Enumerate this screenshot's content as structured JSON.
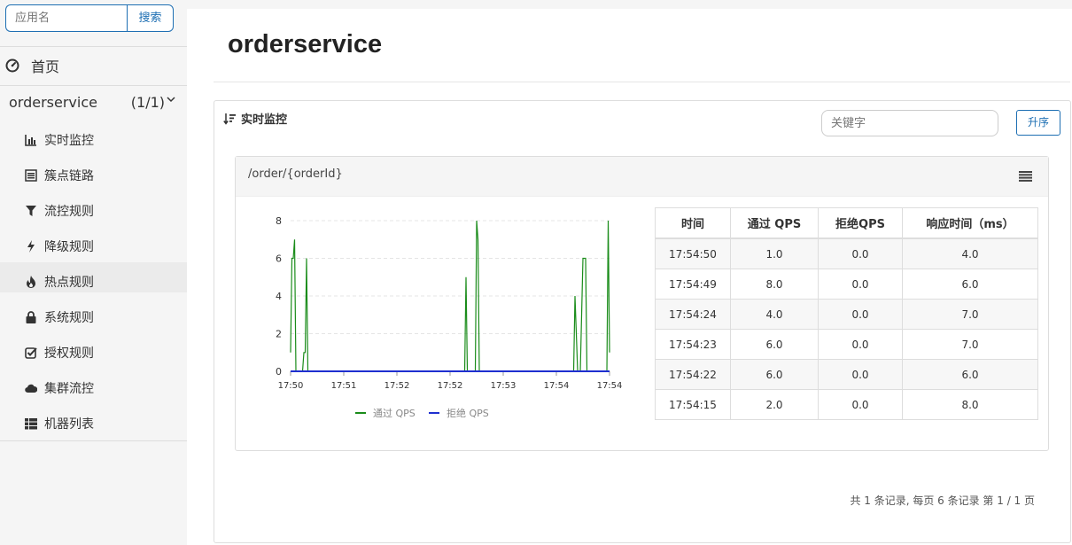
{
  "sidebar": {
    "search": {
      "placeholder": "应用名",
      "button": "搜索"
    },
    "home": {
      "icon": "dashboard-icon",
      "label": "首页"
    },
    "app": {
      "name": "orderservice",
      "count": "(1/1)"
    },
    "menu": [
      {
        "icon": "bar-chart-icon",
        "label": "实时监控"
      },
      {
        "icon": "list-icon",
        "label": "簇点链路"
      },
      {
        "icon": "filter-icon",
        "label": "流控规则"
      },
      {
        "icon": "flash-icon",
        "label": "降级规则"
      },
      {
        "icon": "fire-icon",
        "label": "热点规则"
      },
      {
        "icon": "lock-icon",
        "label": "系统规则"
      },
      {
        "icon": "check-square-icon",
        "label": "授权规则"
      },
      {
        "icon": "cloud-icon",
        "label": "集群流控"
      },
      {
        "icon": "th-list-icon",
        "label": "机器列表"
      }
    ]
  },
  "main": {
    "title": "orderservice",
    "panel": {
      "title": "实时监控",
      "keyword_placeholder": "关键字",
      "sort_button": "升序"
    },
    "resource": {
      "name": "/order/{orderId}"
    },
    "table": {
      "headers": [
        "时间",
        "通过 QPS",
        "拒绝QPS",
        "响应时间（ms）"
      ],
      "rows": [
        [
          "17:54:50",
          "1.0",
          "0.0",
          "4.0"
        ],
        [
          "17:54:49",
          "8.0",
          "0.0",
          "6.0"
        ],
        [
          "17:54:24",
          "4.0",
          "0.0",
          "7.0"
        ],
        [
          "17:54:23",
          "6.0",
          "0.0",
          "7.0"
        ],
        [
          "17:54:22",
          "6.0",
          "0.0",
          "6.0"
        ],
        [
          "17:54:15",
          "2.0",
          "0.0",
          "8.0"
        ]
      ]
    },
    "pagination": "共 1 条记录, 每页 6 条记录 第 1 / 1 页"
  },
  "chart_data": {
    "type": "line",
    "x_ticks": [
      "17:50",
      "17:51",
      "17:52",
      "17:52",
      "17:53",
      "17:54",
      "17:54"
    ],
    "y_ticks": [
      0,
      2,
      4,
      6,
      8
    ],
    "ylim": [
      0,
      8
    ],
    "xlim_seconds": [
      0,
      240
    ],
    "grid": true,
    "legend_position": "bottom",
    "colors": {
      "pass": "#1a8c1a",
      "block": "#1f2fd0"
    },
    "series": [
      {
        "name": "通过 QPS",
        "x_seconds": [
          0,
          1,
          2,
          3,
          4,
          5,
          6,
          7,
          8,
          9,
          10,
          11,
          12,
          13,
          14,
          15,
          16,
          17,
          18,
          19,
          20,
          130,
          131,
          132,
          133,
          134,
          135,
          136,
          137,
          138,
          139,
          140,
          141,
          142,
          143,
          144,
          145,
          210,
          211,
          212,
          213,
          214,
          215,
          216,
          217,
          218,
          219,
          220,
          221,
          222,
          223,
          224,
          236,
          237,
          238,
          239,
          240
        ],
        "values": [
          1,
          6,
          6,
          7,
          0,
          0,
          0,
          0,
          0,
          0,
          1,
          1,
          6,
          0,
          0,
          0,
          0,
          0,
          0,
          0,
          0,
          0,
          0,
          5,
          0,
          0,
          0,
          0,
          0,
          0,
          0,
          8,
          7,
          0,
          0,
          0,
          0,
          0,
          0,
          0,
          0,
          4,
          2,
          0,
          0,
          0,
          3,
          6,
          6,
          6,
          0,
          0,
          0,
          0,
          0,
          8,
          1
        ]
      },
      {
        "name": "拒绝 QPS",
        "x_seconds": [
          0,
          240
        ],
        "values": [
          0,
          0
        ]
      }
    ]
  }
}
